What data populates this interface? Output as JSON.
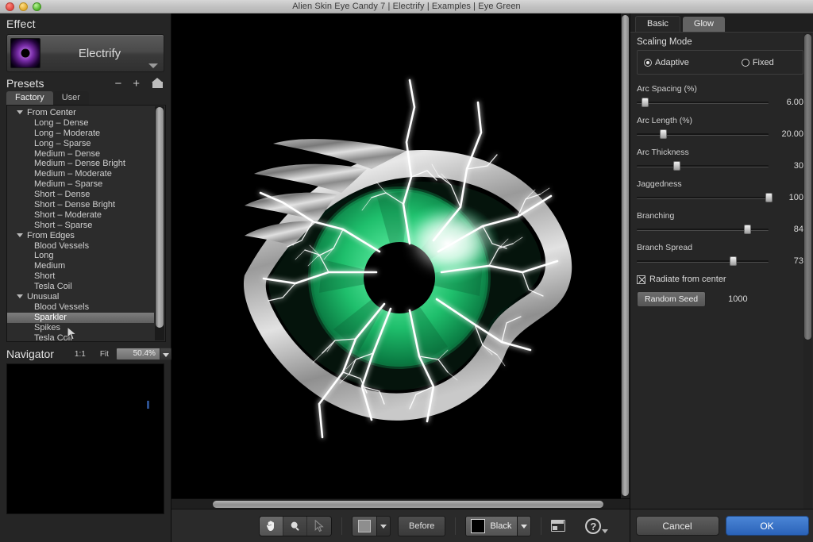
{
  "window": {
    "title": "Alien Skin Eye Candy 7 | Electrify | Examples | Eye Green",
    "traffic_lights": [
      "close-red",
      "minimize-yellow",
      "zoom-green"
    ]
  },
  "left_panel": {
    "effect_section_title": "Effect",
    "effect": {
      "name": "Electrify",
      "icon": "electrify-thumbnail-icon",
      "dropdown_arrow": "chevron-down-icon"
    },
    "presets_section_title": "Presets",
    "presets_actions": {
      "remove_label": "−",
      "add_label": "+",
      "home_icon": "home-icon"
    },
    "preset_tabs": [
      {
        "label": "Factory",
        "active": true
      },
      {
        "label": "User",
        "active": false
      }
    ],
    "preset_tree": [
      {
        "type": "group",
        "label": "From Center",
        "expanded": true
      },
      {
        "type": "item",
        "label": "Long – Dense",
        "selected": false
      },
      {
        "type": "item",
        "label": "Long – Moderate",
        "selected": false
      },
      {
        "type": "item",
        "label": "Long – Sparse",
        "selected": false
      },
      {
        "type": "item",
        "label": "Medium – Dense",
        "selected": false
      },
      {
        "type": "item",
        "label": "Medium – Dense Bright",
        "selected": false
      },
      {
        "type": "item",
        "label": "Medium – Moderate",
        "selected": false
      },
      {
        "type": "item",
        "label": "Medium – Sparse",
        "selected": false
      },
      {
        "type": "item",
        "label": "Short – Dense",
        "selected": false
      },
      {
        "type": "item",
        "label": "Short – Dense Bright",
        "selected": false
      },
      {
        "type": "item",
        "label": "Short – Moderate",
        "selected": false
      },
      {
        "type": "item",
        "label": "Short – Sparse",
        "selected": false
      },
      {
        "type": "group",
        "label": "From Edges",
        "expanded": true
      },
      {
        "type": "item",
        "label": "Blood Vessels",
        "selected": false
      },
      {
        "type": "item",
        "label": "Long",
        "selected": false
      },
      {
        "type": "item",
        "label": "Medium",
        "selected": false
      },
      {
        "type": "item",
        "label": "Short",
        "selected": false
      },
      {
        "type": "item",
        "label": "Tesla Coil",
        "selected": false
      },
      {
        "type": "group",
        "label": "Unusual",
        "expanded": true
      },
      {
        "type": "item",
        "label": "Blood Vessels",
        "selected": false
      },
      {
        "type": "item",
        "label": "Sparkler",
        "selected": true
      },
      {
        "type": "item",
        "label": "Spikes",
        "selected": false
      },
      {
        "type": "item",
        "label": "Tesla Coil",
        "selected": false
      }
    ],
    "navigator": {
      "title": "Navigator",
      "one_to_one": "1:1",
      "fit": "Fit",
      "zoom_value": "50.4%",
      "zoom_dropdown_icon": "chevron-down-icon"
    }
  },
  "canvas": {
    "preview_name": "eye-green-electrify-preview",
    "background_color": "#000000",
    "vertical_scrollbar": "canvas-vertical-scrollbar",
    "horizontal_scrollbar": "canvas-horizontal-scrollbar"
  },
  "bottom_bar": {
    "tools": [
      {
        "name": "pan-hand-tool",
        "glyph": "hand-icon",
        "active": true
      },
      {
        "name": "zoom-tool",
        "glyph": "magnifier-icon",
        "active": false
      },
      {
        "name": "select-arrow-tool",
        "glyph": "arrow-cursor-icon",
        "active": false
      }
    ],
    "preview_swatch_icon": "preview-layout-icon",
    "preview_dropdown_icon": "chevron-down-icon",
    "before_label": "Before",
    "background_color_label": "Black",
    "background_color_hex": "#000000",
    "background_dropdown_icon": "chevron-down-icon",
    "settings_icon": "settings-window-icon",
    "help_icon": "help-question-icon",
    "help_dropdown_icon": "chevron-down-icon"
  },
  "right_panel": {
    "tabs": [
      {
        "label": "Basic",
        "active": true
      },
      {
        "label": "Glow",
        "active": false
      }
    ],
    "scaling_mode": {
      "label": "Scaling Mode",
      "options": [
        {
          "label": "Adaptive",
          "selected": true
        },
        {
          "label": "Fixed",
          "selected": false
        }
      ]
    },
    "parameters": [
      {
        "label": "Arc Spacing (%)",
        "value": "6.00",
        "percent": 6
      },
      {
        "label": "Arc Length (%)",
        "value": "20.00",
        "percent": 20
      },
      {
        "label": "Arc Thickness",
        "value": "30",
        "percent": 30
      },
      {
        "label": "Jaggedness",
        "value": "100",
        "percent": 100
      },
      {
        "label": "Branching",
        "value": "84",
        "percent": 84
      },
      {
        "label": "Branch Spread",
        "value": "73",
        "percent": 73
      }
    ],
    "radiate_from_center": {
      "label": "Radiate from center",
      "checked": true
    },
    "random_seed": {
      "button_label": "Random Seed",
      "value": "1000"
    },
    "footer": {
      "cancel_label": "Cancel",
      "ok_label": "OK",
      "ok_color": "#2a62b8"
    }
  }
}
